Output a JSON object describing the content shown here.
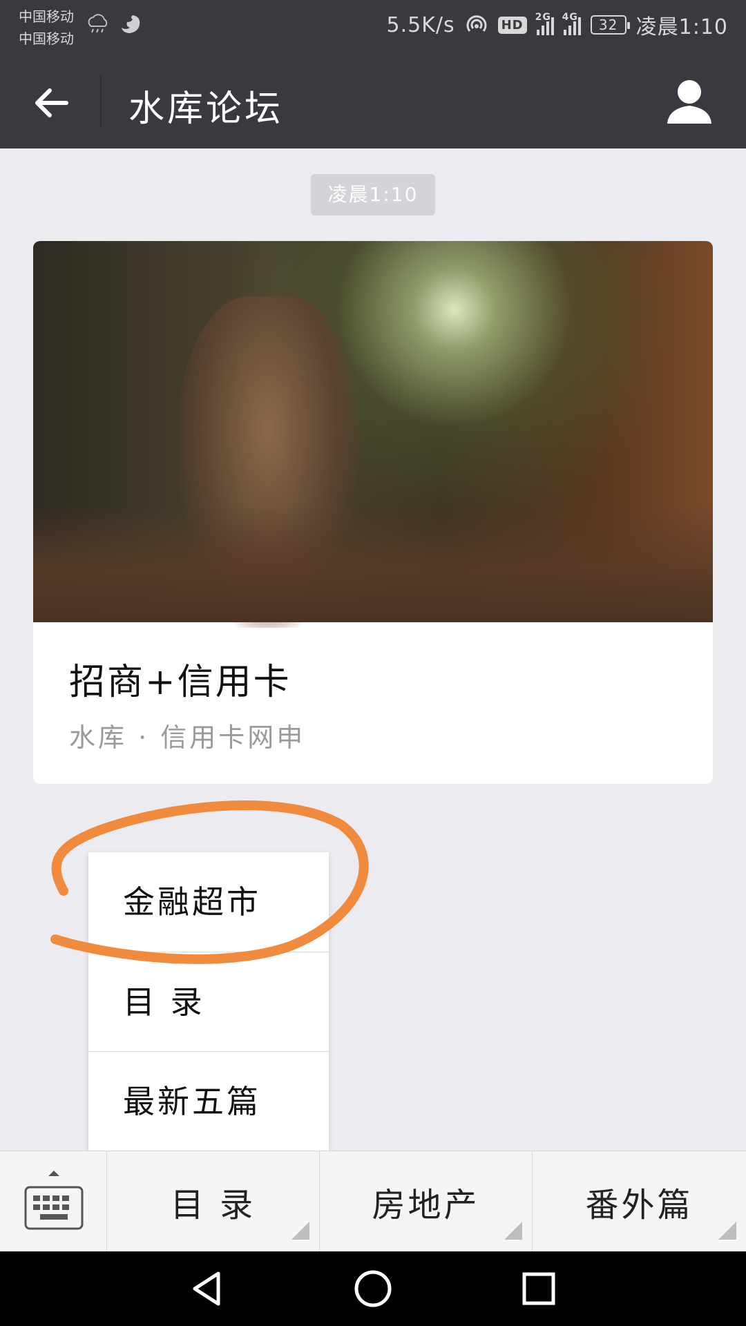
{
  "status_bar": {
    "carrier_1": "中国移动",
    "carrier_2": "中国移动",
    "net_speed": "5.5K/s",
    "hd_label": "HD",
    "signal_1_label": "2G",
    "signal_2_label": "4G",
    "battery": "32",
    "time": "凌晨1:10",
    "icons": [
      "weather-rain-icon",
      "squirrel-app-icon",
      "hotspot-icon",
      "signal-icon",
      "battery-icon"
    ]
  },
  "header": {
    "title": "水库论坛",
    "back_icon": "arrow-left-icon",
    "profile_icon": "person-icon"
  },
  "chat": {
    "timestamp": "凌晨1:10",
    "article": {
      "title": "招商+信用卡",
      "subtitle": "水库 · 信用卡网申"
    }
  },
  "popup_menu": {
    "items": [
      {
        "label": "金融超市"
      },
      {
        "label": "目 录"
      },
      {
        "label": "最新五篇"
      }
    ],
    "annotation_color": "#f08a3c"
  },
  "bottom_menu": {
    "keyboard_icon": "keyboard-icon",
    "tabs": [
      {
        "label": "目 录"
      },
      {
        "label": "房地产"
      },
      {
        "label": "番外篇"
      }
    ]
  },
  "nav_bar": {
    "icons": [
      "back-triangle-icon",
      "home-circle-icon",
      "recents-square-icon"
    ]
  }
}
